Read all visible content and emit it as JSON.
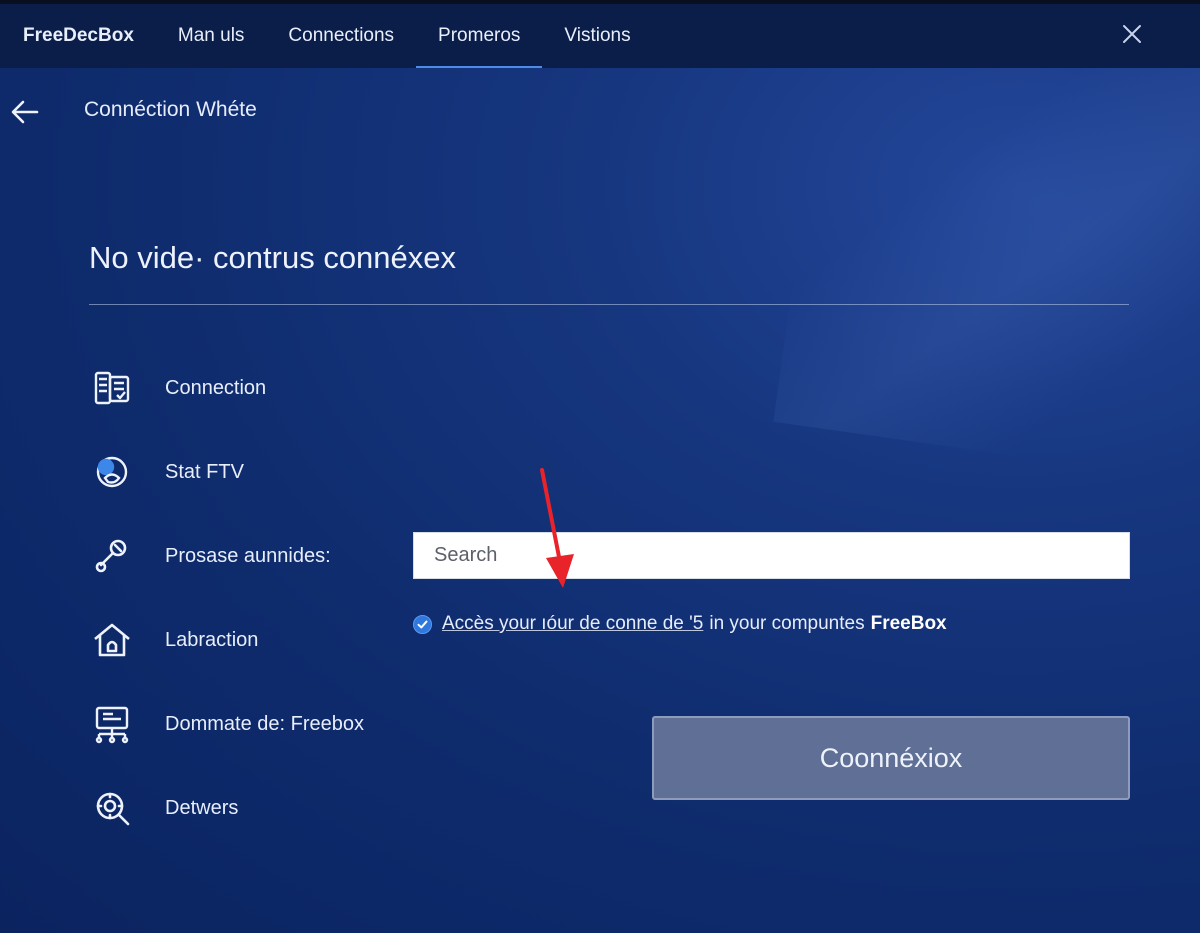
{
  "app": {
    "brand": "FreeDecBox",
    "nav": [
      {
        "label": "Man uls",
        "active": false
      },
      {
        "label": "Connections",
        "active": false
      },
      {
        "label": "Promeros",
        "active": true
      },
      {
        "label": "Vistions",
        "active": false
      }
    ]
  },
  "header": {
    "title": "Connéction Whéte"
  },
  "main": {
    "section_title": "No vide· contrus connéxex",
    "menu": [
      {
        "label": "Connection",
        "icon": "grid-device-icon"
      },
      {
        "label": "Stat FTV",
        "icon": "globe-chat-icon"
      },
      {
        "label": "Prosase aunnides:",
        "icon": "wrench-key-icon"
      },
      {
        "label": "Labraction",
        "icon": "home-icon"
      },
      {
        "label": "Dommate de: Freebox",
        "icon": "monitor-network-icon"
      },
      {
        "label": "Detwers",
        "icon": "search-gear-icon"
      }
    ],
    "search": {
      "placeholder": "Search",
      "value": ""
    },
    "checkbox": {
      "checked": true,
      "link_text": "Accès your ıóur de conne de '5",
      "rest_text": "in your compuntes",
      "brand_text": "FreeBox"
    },
    "connect_button": {
      "label": "Coonnéxiox"
    }
  },
  "colors": {
    "background": "#0f2c6e",
    "topbar": "#0b1e4a",
    "accent": "#4d8be6",
    "button": "#5f6f95",
    "annotation": "#e8232a"
  }
}
